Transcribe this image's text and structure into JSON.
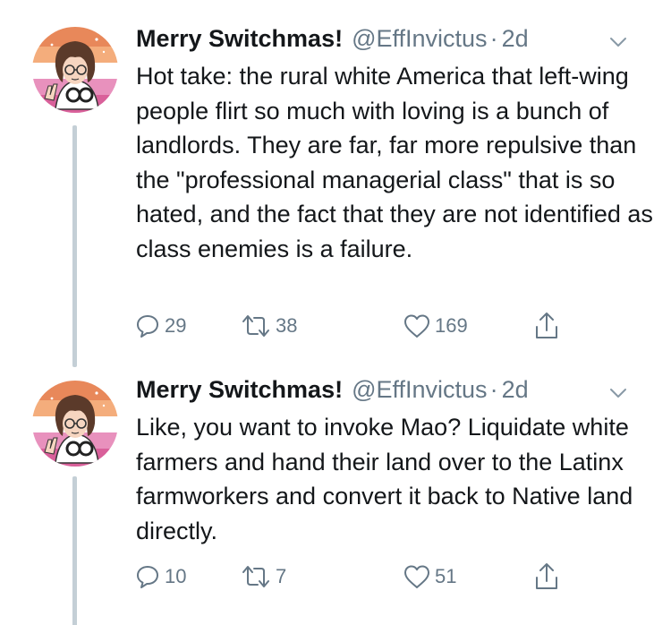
{
  "tweets": [
    {
      "display_name": "Merry Switchmas!",
      "handle": "@EffInvictus",
      "separator": "·",
      "time": "2d",
      "text": "Hot take: the rural white America that left-wing people flirt so much with loving is a bunch of landlords. They are far, far more repulsive than the \"professional managerial class\" that is so hated, and the fact that they are not identified as class enemies is a failure.",
      "replies": "29",
      "retweets": "38",
      "likes": "169"
    },
    {
      "display_name": "Merry Switchmas!",
      "handle": "@EffInvictus",
      "separator": "·",
      "time": "2d",
      "text": "Like, you want to invoke Mao? Liquidate white farmers and hand their land over to the Latinx farmworkers and convert it back to Native land directly.",
      "replies": "10",
      "retweets": "7",
      "likes": "51"
    }
  ],
  "icons": {
    "reply": "reply-icon",
    "retweet": "retweet-icon",
    "like": "heart-icon",
    "share": "share-icon",
    "caret": "chevron-down-icon",
    "avatar": "avatar"
  },
  "colors": {
    "text": "#14171a",
    "secondary": "#657786",
    "thread_line": "#c4cfd6",
    "avatar_bg_top": "#e8885a",
    "avatar_bg_mid": "#f4ad7c",
    "avatar_bg_low": "#ffffff",
    "avatar_bg_pink": "#d9609a"
  }
}
